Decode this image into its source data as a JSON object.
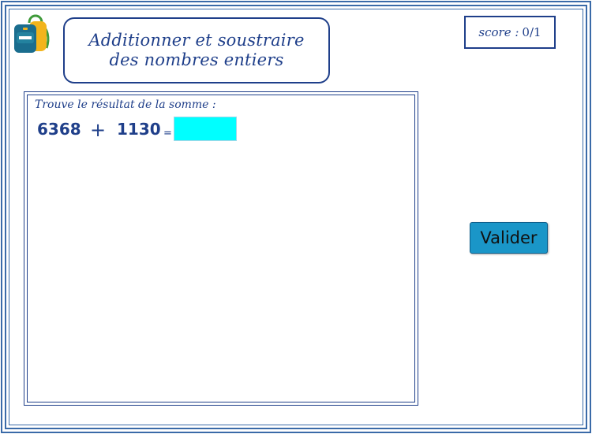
{
  "title": {
    "line1": "Additionner et soustraire",
    "line2": "des nombres entiers"
  },
  "score": {
    "label": "score :",
    "value": "0/1"
  },
  "exercise": {
    "instruction": "Trouve le résultat de la somme :",
    "operand1": "6368",
    "operator": "+",
    "operand2": "1130",
    "equals": "=",
    "answer_value": ""
  },
  "buttons": {
    "validate_label": "Valider"
  },
  "colors": {
    "frame": "#3a6aa8",
    "text": "#1f3f8a",
    "answer_bg": "#00ffff",
    "button_bg": "#1a96c8"
  },
  "icons": {
    "logo": "backpack-icon"
  }
}
